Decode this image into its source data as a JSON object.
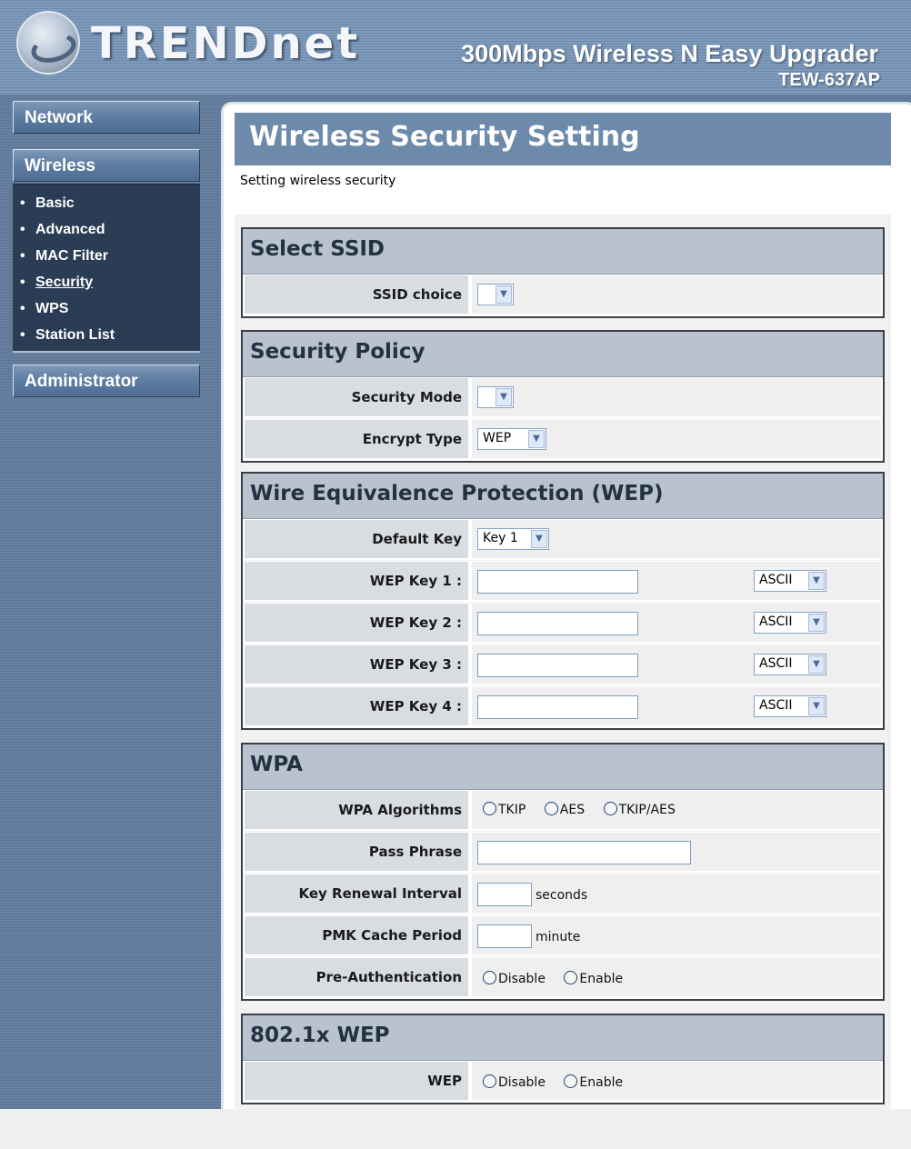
{
  "header": {
    "brand": "TRENDnet",
    "product": "300Mbps Wireless N Easy Upgrader",
    "model": "TEW-637AP"
  },
  "sidebar": {
    "network": "Network",
    "wireless": "Wireless",
    "bullet": "•",
    "items": [
      {
        "label": "Basic"
      },
      {
        "label": "Advanced"
      },
      {
        "label": "MAC Filter"
      },
      {
        "label": "Security",
        "active": true
      },
      {
        "label": "WPS"
      },
      {
        "label": "Station List"
      }
    ],
    "administrator": "Administrator"
  },
  "main": {
    "title": "Wireless Security Setting",
    "description": "Setting wireless security"
  },
  "select_ssid": {
    "heading": "Select SSID",
    "ssid_choice_label": "SSID choice",
    "ssid_choice_value": ""
  },
  "security_policy": {
    "heading": "Security Policy",
    "mode_label": "Security Mode",
    "mode_value": "",
    "encrypt_label": "Encrypt Type",
    "encrypt_value": "WEP"
  },
  "wep": {
    "heading": "Wire Equivalence Protection (WEP)",
    "default_key_label": "Default Key",
    "default_key_value": "Key 1",
    "keys": [
      {
        "label": "WEP Key 1 :",
        "value": "",
        "format": "ASCII"
      },
      {
        "label": "WEP Key 2 :",
        "value": "",
        "format": "ASCII"
      },
      {
        "label": "WEP Key 3 :",
        "value": "",
        "format": "ASCII"
      },
      {
        "label": "WEP Key 4 :",
        "value": "",
        "format": "ASCII"
      }
    ]
  },
  "wpa": {
    "heading": "WPA",
    "algorithms_label": "WPA Algorithms",
    "algorithms": [
      "TKIP",
      "AES",
      "TKIP/AES"
    ],
    "pass_phrase_label": "Pass Phrase",
    "pass_phrase_value": "",
    "renewal_label": "Key Renewal Interval",
    "renewal_value": "",
    "renewal_unit": "seconds",
    "pmk_label": "PMK Cache Period",
    "pmk_value": "",
    "pmk_unit": "minute",
    "preauth_label": "Pre-Authentication",
    "preauth_options": [
      "Disable",
      "Enable"
    ]
  },
  "dot1x": {
    "heading": "802.1x WEP",
    "wep_label": "WEP",
    "wep_options": [
      "Disable",
      "Enable"
    ]
  },
  "icons": {
    "dropdown": "▼"
  }
}
